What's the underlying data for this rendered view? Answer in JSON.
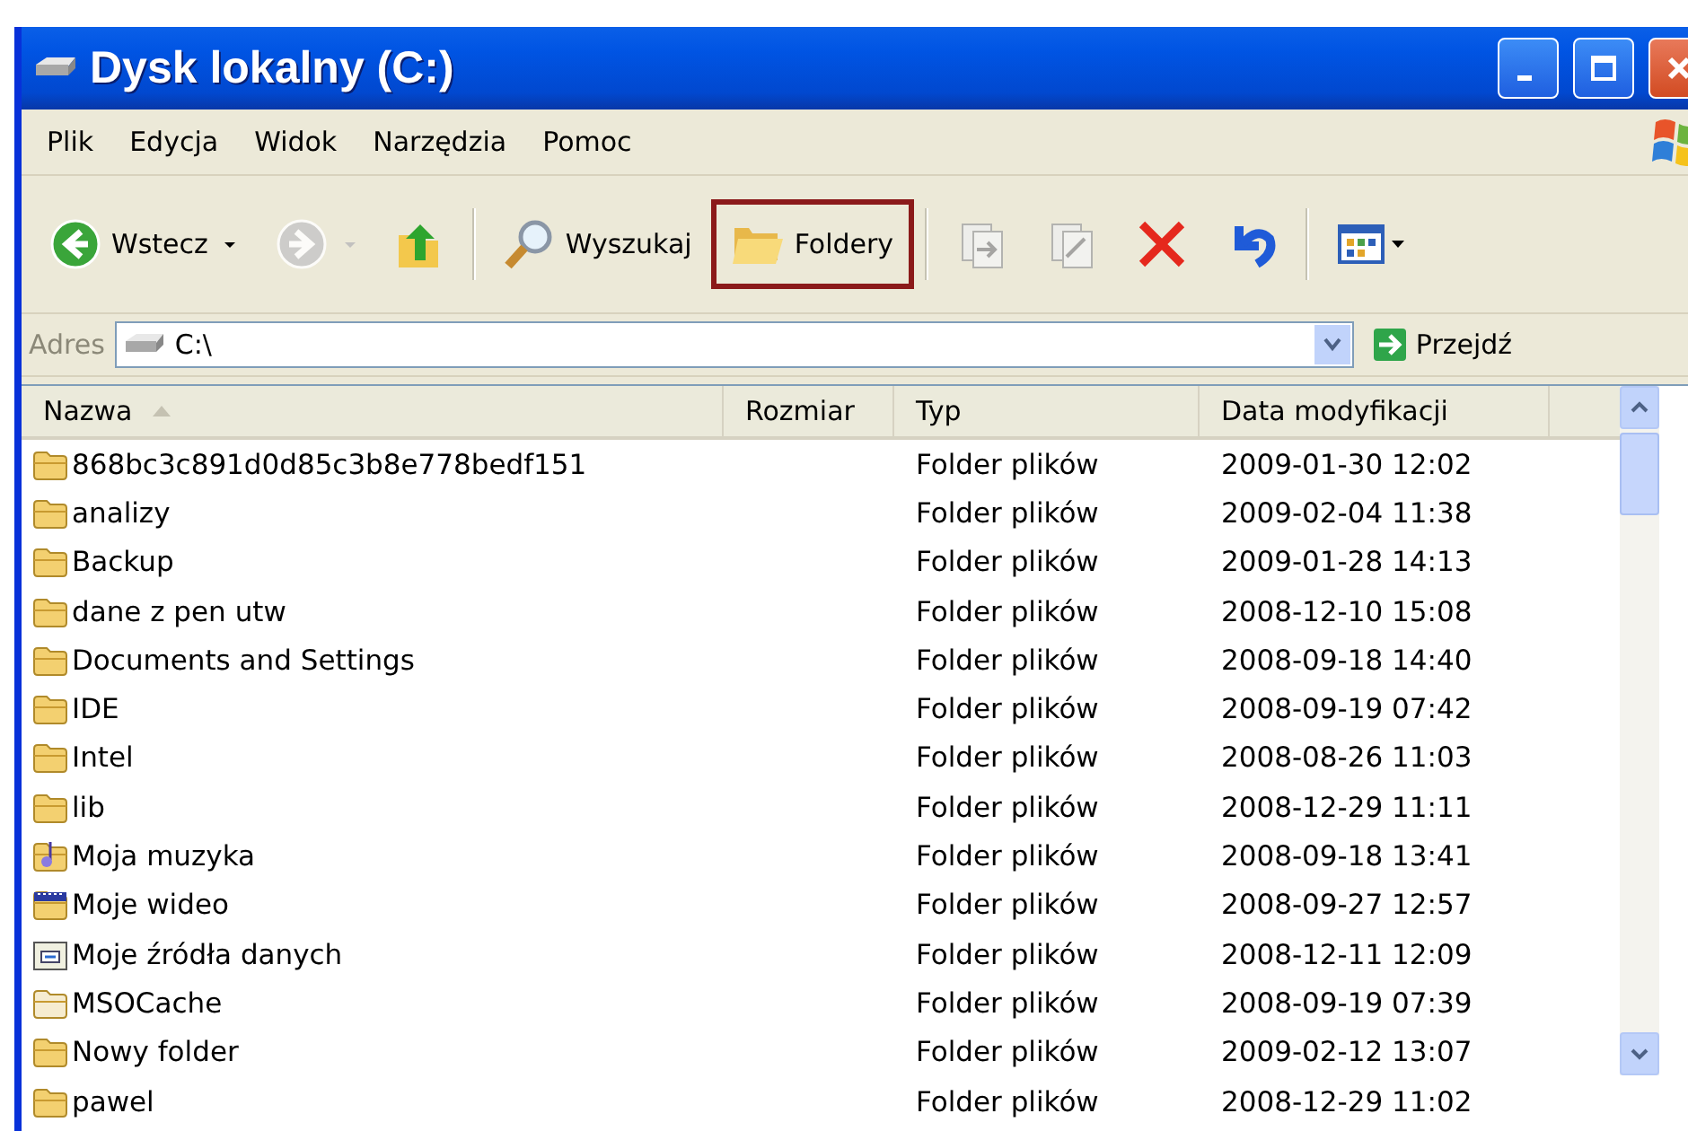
{
  "window": {
    "title": "Dysk lokalny (C:)"
  },
  "menu": [
    "Plik",
    "Edycja",
    "Widok",
    "Narzędzia",
    "Pomoc"
  ],
  "toolbar": [
    {
      "kind": "back",
      "label": "Wstecz",
      "disabled": false,
      "highlighted": false
    },
    {
      "kind": "forward",
      "disabled": true,
      "highlighted": false
    },
    {
      "kind": "up",
      "disabled": false,
      "highlighted": false
    },
    {
      "kind": "search",
      "label": "Wyszukaj",
      "disabled": false,
      "highlighted": false
    },
    {
      "kind": "folders",
      "label": "Foldery",
      "disabled": false,
      "highlighted": true
    },
    {
      "kind": "move",
      "disabled": true,
      "highlighted": false
    },
    {
      "kind": "copy",
      "disabled": true,
      "highlighted": false
    },
    {
      "kind": "delete",
      "disabled": false,
      "highlighted": false
    },
    {
      "kind": "undo",
      "disabled": false,
      "highlighted": false
    },
    {
      "kind": "views",
      "disabled": false,
      "highlighted": false
    }
  ],
  "address": {
    "label": "Adres",
    "value": "C:\\",
    "go_label": "Przejdź"
  },
  "table": {
    "columns": [
      {
        "label": "Nazwa",
        "sorted": true
      },
      {
        "label": "Rozmiar",
        "sorted": false
      },
      {
        "label": "Typ",
        "sorted": false
      },
      {
        "label": "Data modyfikacji",
        "sorted": false
      }
    ],
    "rows": [
      {
        "kind": "folder",
        "name": "868bc3c891d0d85c3b8e778bedf151",
        "type": "Folder plików",
        "modified": "2009-01-30 12:02"
      },
      {
        "kind": "folder",
        "name": "analizy",
        "type": "Folder plików",
        "modified": "2009-02-04 11:38"
      },
      {
        "kind": "folder",
        "name": "Backup",
        "type": "Folder plików",
        "modified": "2009-01-28 14:13"
      },
      {
        "kind": "folder",
        "name": "dane z pen utw",
        "type": "Folder plików",
        "modified": "2008-12-10 15:08"
      },
      {
        "kind": "folder",
        "name": "Documents and Settings",
        "type": "Folder plików",
        "modified": "2008-09-18 14:40"
      },
      {
        "kind": "folder",
        "name": "IDE",
        "type": "Folder plików",
        "modified": "2008-09-19 07:42"
      },
      {
        "kind": "folder",
        "name": "Intel",
        "type": "Folder plików",
        "modified": "2008-08-26 11:03"
      },
      {
        "kind": "folder",
        "name": "lib",
        "type": "Folder plików",
        "modified": "2008-12-29 11:11"
      },
      {
        "kind": "music",
        "name": "Moja muzyka",
        "type": "Folder plików",
        "modified": "2008-09-18 13:41"
      },
      {
        "kind": "video",
        "name": "Moje wideo",
        "type": "Folder plików",
        "modified": "2008-09-27 12:57"
      },
      {
        "kind": "data",
        "name": "Moje źródła danych",
        "type": "Folder plików",
        "modified": "2008-12-11 12:09"
      },
      {
        "kind": "hidden",
        "name": "MSOCache",
        "type": "Folder plików",
        "modified": "2008-09-19 07:39"
      },
      {
        "kind": "folder",
        "name": "Nowy folder",
        "type": "Folder plików",
        "modified": "2009-02-12 13:07"
      },
      {
        "kind": "folder",
        "name": "pawel",
        "type": "Folder plików",
        "modified": "2008-12-29 11:02"
      }
    ]
  }
}
